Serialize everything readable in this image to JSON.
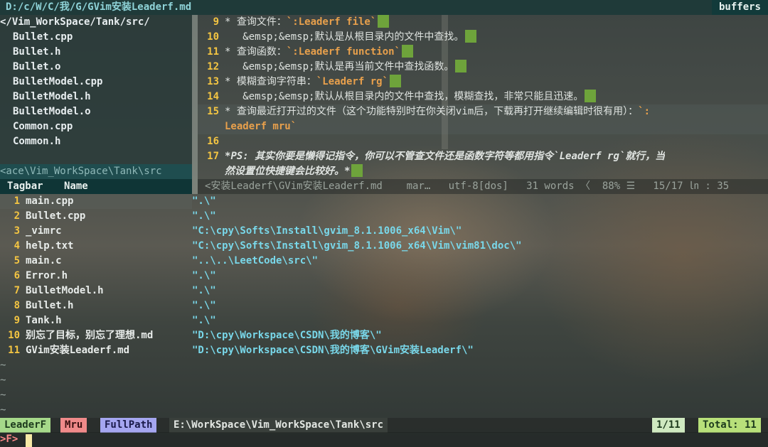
{
  "tabline": {
    "file": "D:/c/W/C/我/G/GVim安装Leaderf.md",
    "buffers": "buffers"
  },
  "nerdtree": {
    "root": "</Vim_WorkSpace/Tank/src/",
    "files": [
      "Bullet.cpp",
      "Bullet.h",
      "Bullet.o",
      "BulletModel.cpp",
      "BulletModel.h",
      "BulletModel.o",
      "Common.cpp",
      "Common.h"
    ],
    "status": "<ace\\Vim_WorkSpace\\Tank\\src"
  },
  "editor": {
    "lines": [
      {
        "n": "9",
        "pre": "* 查询文件：",
        "code": "`:Leaderf file`",
        "post": ""
      },
      {
        "n": "10",
        "pre": "   &emsp;&emsp;默认是从根目录内的文件中查找。",
        "code": "",
        "post": ""
      },
      {
        "n": "11",
        "pre": "* 查询函数：",
        "code": "`:Leaderf function`",
        "post": ""
      },
      {
        "n": "12",
        "pre": "   &emsp;&emsp;默认是再当前文件中查找函数。",
        "code": "",
        "post": ""
      },
      {
        "n": "13",
        "pre": "* 模糊查询字符串：",
        "code": "`Leaderf rg`",
        "post": ""
      },
      {
        "n": "14",
        "pre": "   &emsp;&emsp;默认从根目录内的文件中查找，模糊查找，非常只能且迅速。",
        "code": "",
        "post": ""
      },
      {
        "n": "15",
        "pre": "* 查询最近打开过的文件（这个功能特别时在你关闭vim后，下载再打开继续编辑时很有用）：",
        "code": "`:",
        "post": ""
      }
    ],
    "wrap15": "Leaderf mru`",
    "line17": {
      "n": "17",
      "a": "*",
      "b": "PS: 其实你要是懒得记指令，你可以不管查文件还是函数字符等都用指令",
      "c": "`Leaderf rg`",
      "d": "就行，当"
    },
    "wrap17": "然设置位快捷键会比较好。*",
    "status": "<安装Leaderf\\GVim安装Leaderf.md    mar…   utf-8[dos]   31 words 〈  88% ☰   15/17 ㏑ : 35"
  },
  "tagbar": {
    "title": "Tagbar",
    "name": "Name"
  },
  "mru": [
    {
      "n": "1",
      "name": "main.cpp",
      "path": "\".\\\""
    },
    {
      "n": "2",
      "name": "Bullet.cpp",
      "path": "\".\\\""
    },
    {
      "n": "3",
      "name": "_vimrc",
      "path": "\"C:\\cpy\\Softs\\Install\\gvim_8.1.1006_x64\\Vim\\\""
    },
    {
      "n": "4",
      "name": "help.txt",
      "path": "\"C:\\cpy\\Softs\\Install\\gvim_8.1.1006_x64\\Vim\\vim81\\doc\\\""
    },
    {
      "n": "5",
      "name": "main.c",
      "path": "\"..\\..\\LeetCode\\src\\\""
    },
    {
      "n": "6",
      "name": "Error.h",
      "path": "\".\\\""
    },
    {
      "n": "7",
      "name": "BulletModel.h",
      "path": "\".\\\""
    },
    {
      "n": "8",
      "name": "Bullet.h",
      "path": "\".\\\""
    },
    {
      "n": "9",
      "name": "Tank.h",
      "path": "\".\\\""
    },
    {
      "n": "10",
      "name": "别忘了目标，别忘了理想.md",
      "path": "\"D:\\cpy\\Workspace\\CSDN\\我的博客\\\""
    },
    {
      "n": "11",
      "name": "GVim安装Leaderf.md",
      "path": "\"D:\\cpy\\Workspace\\CSDN\\我的博客\\GVim安装Leaderf\\\""
    }
  ],
  "tildes": [
    "~",
    "~",
    "~",
    "~"
  ],
  "statusbar": {
    "leaderf": "LeaderF",
    "mru": "Mru",
    "fullpath": "FullPath",
    "cwd": "E:\\WorkSpace\\Vim_WorkSpace\\Tank\\src",
    "count": "1/11",
    "total": "Total: 11",
    "colors": {
      "leaderf": "#a6d98a",
      "mru": "#f08a8a",
      "fullpath": "#a5a6f0",
      "count": "#cfe9c0",
      "total": "#b8e07a"
    }
  },
  "cmdline": {
    "prompt": ">F>"
  }
}
